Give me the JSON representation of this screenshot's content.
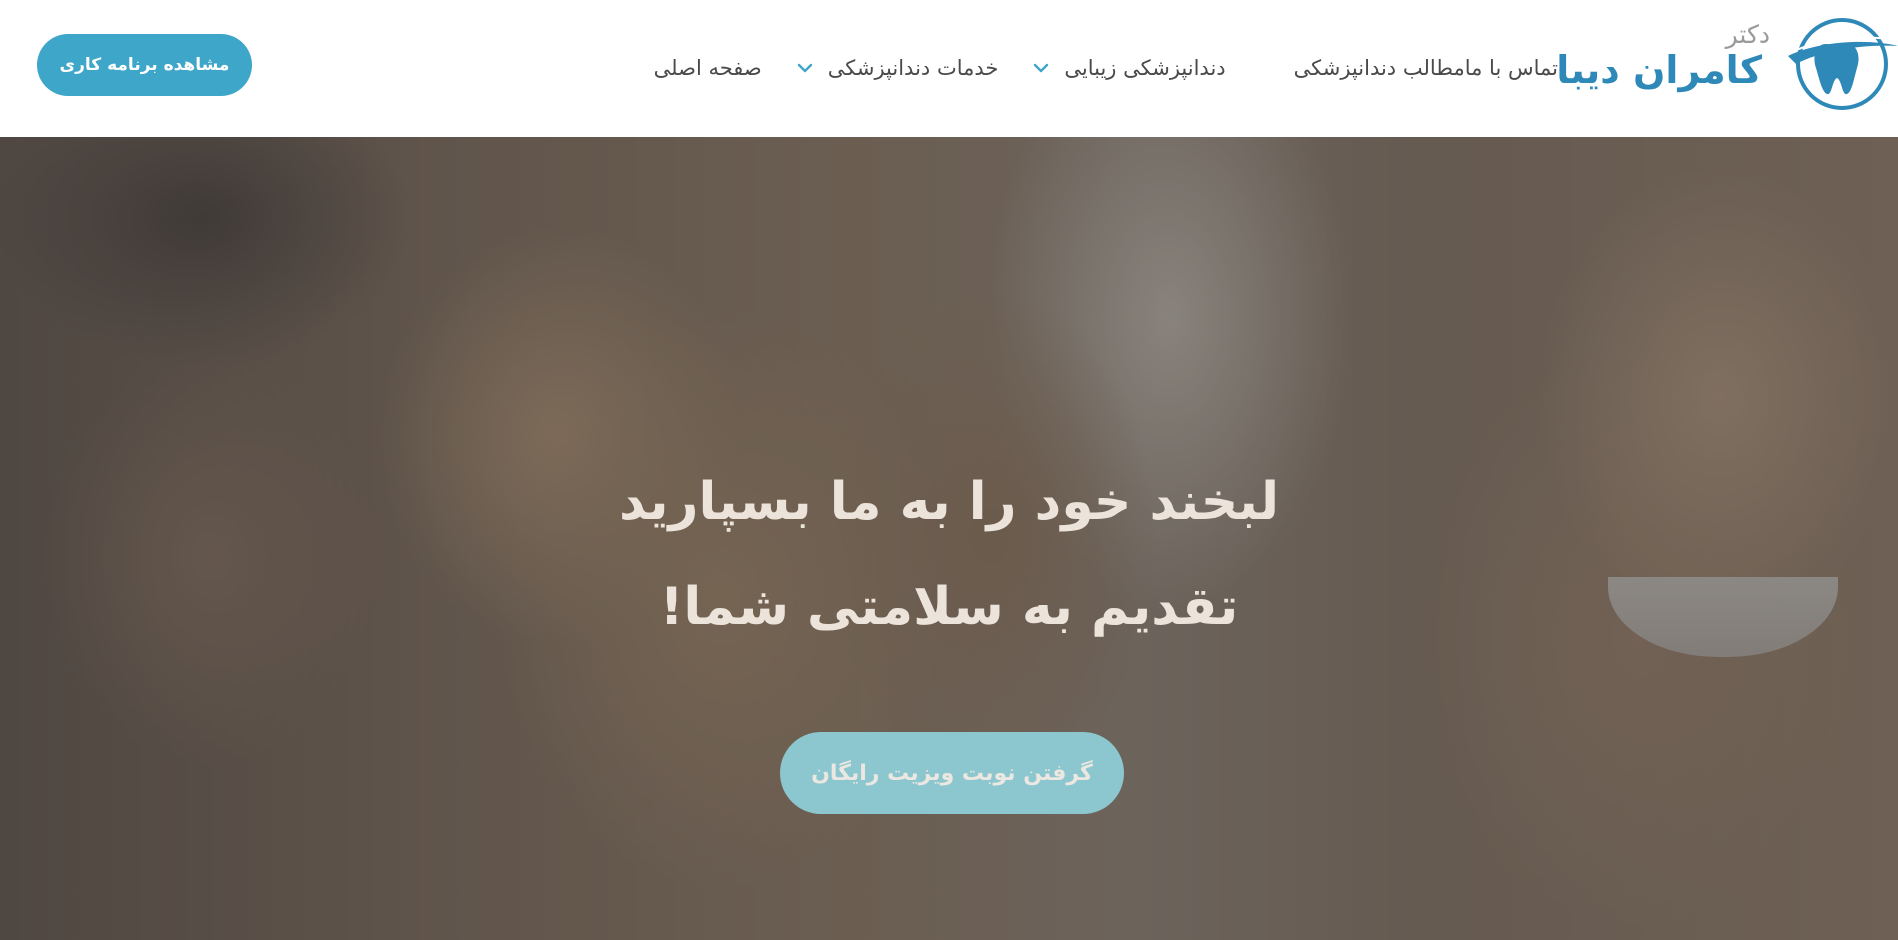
{
  "brand": {
    "prefix": "دکتر",
    "name": "کامران دیبا",
    "emblem_icon": "tooth-circle-logo",
    "color": "#2e89b8"
  },
  "nav": {
    "items": [
      {
        "label": "صفحه اصلی",
        "has_dropdown": false
      },
      {
        "label": "خدمات دندانپزشکی",
        "has_dropdown": true
      },
      {
        "label": "دندانپزشکی زیبایی",
        "has_dropdown": true
      },
      {
        "label": "مطالب دندانپزشکی",
        "has_dropdown": false
      },
      {
        "label": "تماس با ما",
        "has_dropdown": false
      }
    ],
    "dropdown_icon": "chevron-down-icon",
    "accent": "#3ea6c9"
  },
  "header_button": {
    "label": "مشاهده برنامه کاری"
  },
  "hero": {
    "title_line1": "لبخند خود را به ما بسپارید",
    "title_line2": "تقدیم به سلامتی شما!",
    "cta_label": "گرفتن نوبت ویزیت رایگان"
  }
}
